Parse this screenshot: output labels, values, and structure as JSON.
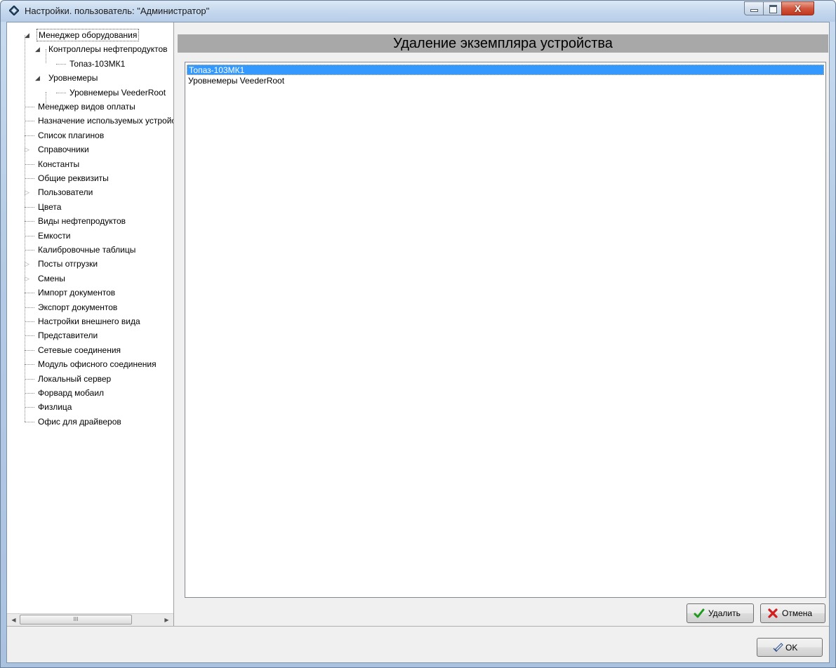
{
  "window": {
    "title": "Настройки. пользователь: \"Администратор\"",
    "close_glyph": "X"
  },
  "tree": {
    "items": [
      {
        "label": "Менеджер оборудования",
        "level": 0,
        "expander": "expanded",
        "selected": true
      },
      {
        "label": "Контроллеры нефтепродуктов",
        "level": 1,
        "expander": "expanded"
      },
      {
        "label": "Топаз-103МК1",
        "level": 2,
        "expander": "none"
      },
      {
        "label": "Уровнемеры",
        "level": 1,
        "expander": "expanded"
      },
      {
        "label": "Уровнемеры VeederRoot",
        "level": 2,
        "expander": "none"
      },
      {
        "label": "Менеджер видов оплаты",
        "level": 0,
        "expander": "none"
      },
      {
        "label": "Назначение используемых устройств",
        "level": 0,
        "expander": "none"
      },
      {
        "label": "Список плагинов",
        "level": 0,
        "expander": "none"
      },
      {
        "label": "Справочники",
        "level": 0,
        "expander": "collapsed"
      },
      {
        "label": "Константы",
        "level": 0,
        "expander": "none"
      },
      {
        "label": "Общие реквизиты",
        "level": 0,
        "expander": "none"
      },
      {
        "label": "Пользователи",
        "level": 0,
        "expander": "collapsed"
      },
      {
        "label": "Цвета",
        "level": 0,
        "expander": "none"
      },
      {
        "label": "Виды нефтепродуктов",
        "level": 0,
        "expander": "none"
      },
      {
        "label": "Емкости",
        "level": 0,
        "expander": "none"
      },
      {
        "label": "Калибровочные таблицы",
        "level": 0,
        "expander": "none"
      },
      {
        "label": "Посты отгрузки",
        "level": 0,
        "expander": "collapsed"
      },
      {
        "label": "Смены",
        "level": 0,
        "expander": "collapsed"
      },
      {
        "label": "Импорт документов",
        "level": 0,
        "expander": "none"
      },
      {
        "label": "Экспорт документов",
        "level": 0,
        "expander": "none"
      },
      {
        "label": "Настройки внешнего вида",
        "level": 0,
        "expander": "none"
      },
      {
        "label": "Представители",
        "level": 0,
        "expander": "none"
      },
      {
        "label": "Сетевые соединения",
        "level": 0,
        "expander": "none"
      },
      {
        "label": "Модуль офисного соединения",
        "level": 0,
        "expander": "none"
      },
      {
        "label": "Локальный сервер",
        "level": 0,
        "expander": "none"
      },
      {
        "label": "Форвард мобаил",
        "level": 0,
        "expander": "none"
      },
      {
        "label": "Физлица",
        "level": 0,
        "expander": "none"
      },
      {
        "label": "Офис для драйверов",
        "level": 0,
        "expander": "none"
      }
    ],
    "scroll_thumb_glyph": "III"
  },
  "main": {
    "title": "Удаление экземпляра устройства",
    "list": [
      {
        "label": "Топаз-103МК1",
        "selected": true
      },
      {
        "label": "Уровнемеры VeederRoot",
        "selected": false
      }
    ]
  },
  "buttons": {
    "delete_label": "Удалить",
    "cancel_label": "Отмена",
    "ok_label": "OK"
  },
  "colors": {
    "selection": "#3399ff",
    "header_band": "#a8a8a8",
    "delete_icon": "#1f9a1f",
    "cancel_icon": "#d21e1e"
  },
  "icons": {
    "app": "diamond-icon",
    "delete": "checkmark-icon",
    "cancel": "x-mark-icon",
    "ok": "pencil-check-icon"
  }
}
